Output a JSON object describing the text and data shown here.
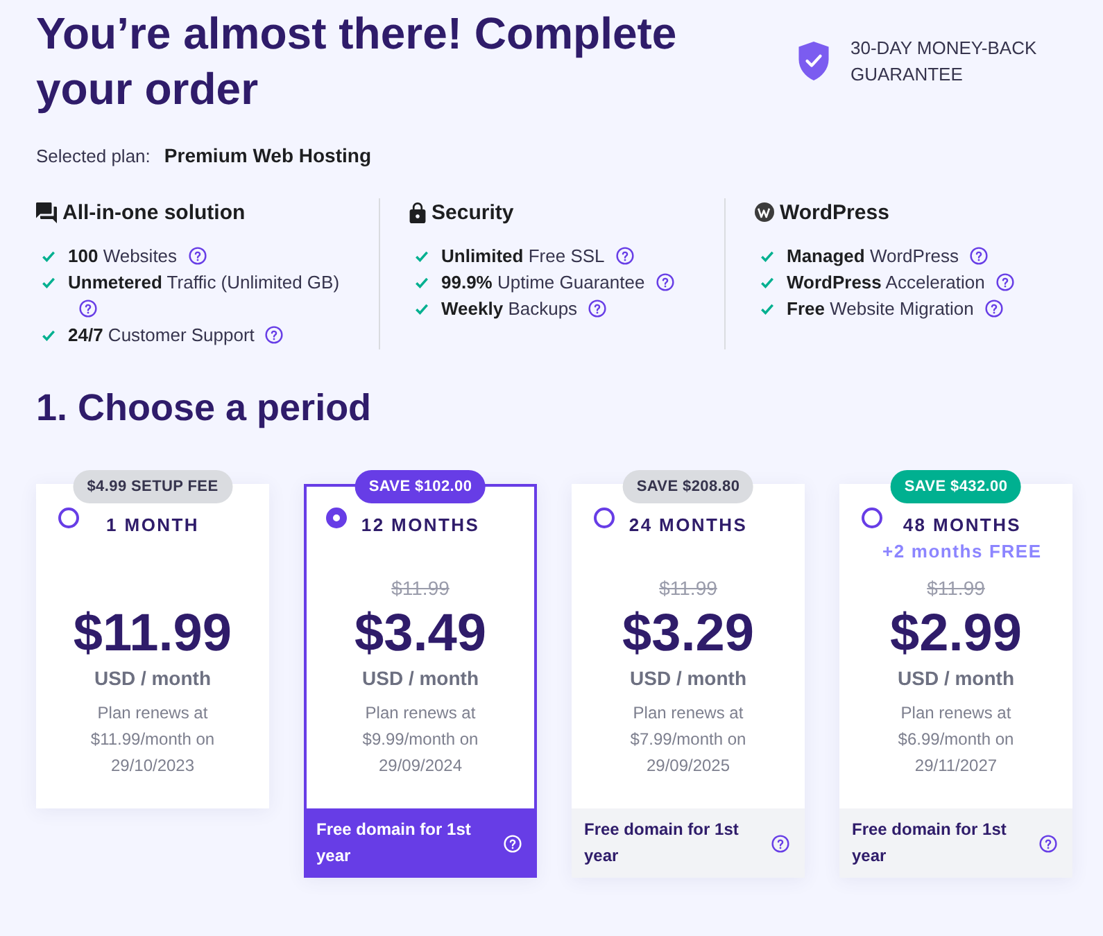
{
  "header": {
    "title": "You’re almost there! Complete your order",
    "guarantee": "30-DAY MONEY-BACK GUARANTEE"
  },
  "selected_plan": {
    "label": "Selected plan:",
    "value": "Premium Web Hosting"
  },
  "feature_groups": [
    {
      "title": "All-in-one solution",
      "items": [
        "**100** Websites",
        "**Unmetered** Traffic (Unlimited GB)",
        "**24/7** Customer Support"
      ]
    },
    {
      "title": "Security",
      "items": [
        "**Unlimited** Free SSL",
        "**99.9%** Uptime Guarantee",
        "**Weekly** Backups"
      ]
    },
    {
      "title": "WordPress",
      "items": [
        "**Managed** WordPress",
        "**WordPress** Acceleration",
        "**Free** Website Migration"
      ]
    }
  ],
  "period_section": {
    "title": "1. Choose a period",
    "plans": [
      {
        "selected": false,
        "badge": {
          "text": "$4.99 SETUP FEE",
          "color": "#dadce0"
        },
        "period": "1 MONTH",
        "price": "$11.99",
        "unit": "USD / month",
        "renewal": "Plan renews at $11.99/month on 29/10/2023"
      },
      {
        "selected": true,
        "badge": {
          "text": "SAVE $102.00",
          "color": "#673de6"
        },
        "period": "12 MONTHS",
        "old_price": "$11.99",
        "price": "$3.49",
        "unit": "USD / month",
        "renewal": "Plan renews at $9.99/month on 29/09/2024",
        "footer": "Free domain for 1st year"
      },
      {
        "selected": false,
        "badge": {
          "text": "SAVE $208.80",
          "color": "#dadce0"
        },
        "period": "24 MONTHS",
        "old_price": "$11.99",
        "price": "$3.29",
        "unit": "USD / month",
        "renewal": "Plan renews at $7.99/month on 29/09/2025",
        "footer": "Free domain for 1st year"
      },
      {
        "selected": false,
        "badge": {
          "text": "SAVE $432.00",
          "color": "#00b090"
        },
        "period": "48 MONTHS",
        "bonus": "+2 months FREE",
        "old_price": "$11.99",
        "price": "$2.99",
        "unit": "USD / month",
        "renewal": "Plan renews at $6.99/month on 29/11/2027",
        "footer": "Free domain for 1st year"
      }
    ]
  }
}
